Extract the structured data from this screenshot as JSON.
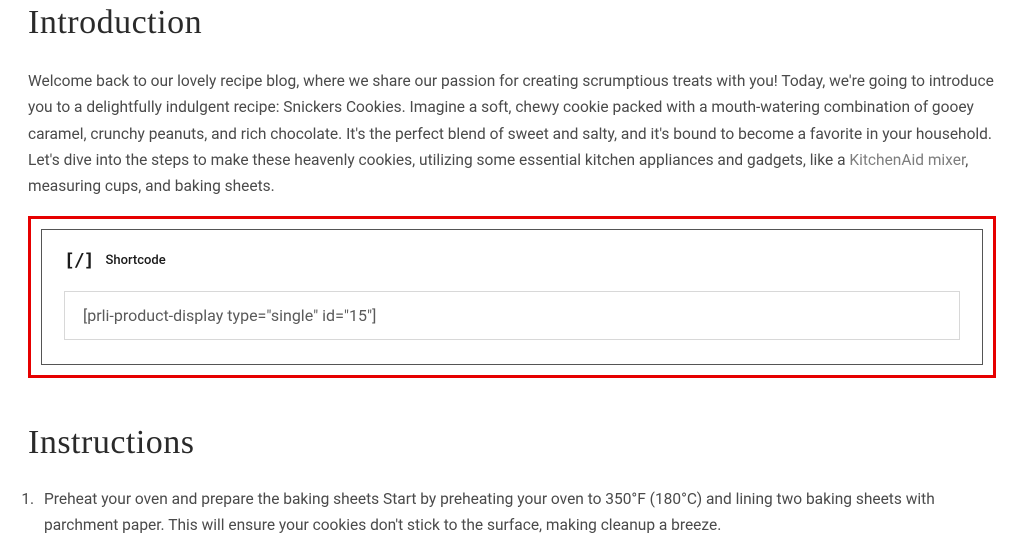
{
  "intro": {
    "heading": "Introduction",
    "body_before_link": "Welcome back to our lovely recipe blog, where we share our passion for creating scrumptious treats with you! Today, we're going to introduce you to a delightfully indulgent recipe: Snickers Cookies. Imagine a soft, chewy cookie packed with a mouth-watering combination of gooey caramel, crunchy peanuts, and rich chocolate. It's the perfect blend of sweet and salty, and it's bound to become a favorite in your household. Let's dive into the steps to make these heavenly cookies, utilizing some essential kitchen appliances and gadgets, like a ",
    "link_text": "KitchenAid mixer",
    "body_after_link": ", measuring cups, and baking sheets."
  },
  "shortcode": {
    "icon_glyph": "[/]",
    "label": "Shortcode",
    "value": "[prli-product-display type=\"single\" id=\"15\"]"
  },
  "instructions": {
    "heading": "Instructions",
    "steps": [
      "Preheat your oven and prepare the baking sheets Start by preheating your oven to 350°F (180°C) and lining two baking sheets with parchment paper. This will ensure your cookies don't stick to the surface, making cleanup a breeze."
    ]
  }
}
